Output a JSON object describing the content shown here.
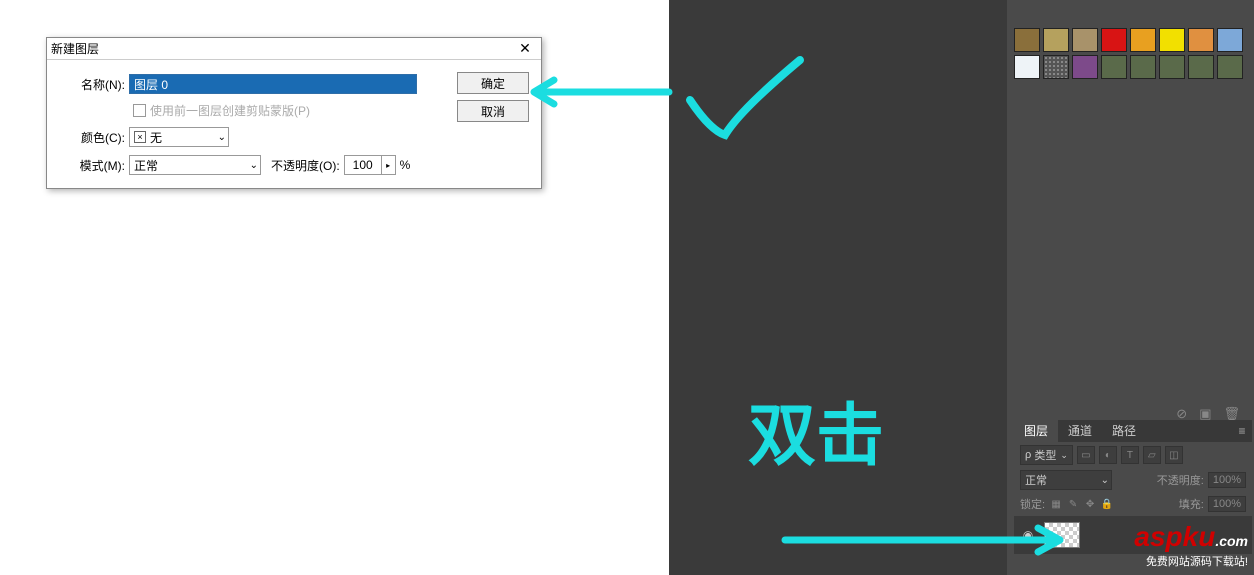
{
  "dialog": {
    "title": "新建图层",
    "name_label": "名称(N):",
    "name_value": "图层 0",
    "clip_mask_label": "使用前一图层创建剪贴蒙版(P)",
    "color_label": "颜色(C):",
    "color_value": "无",
    "mode_label": "模式(M):",
    "mode_value": "正常",
    "opacity_label": "不透明度(O):",
    "opacity_value": "100",
    "opacity_unit": "%",
    "ok": "确定",
    "cancel": "取消"
  },
  "swatches": [
    "#8a6f3b",
    "#b5a15e",
    "#a8926a",
    "#d81414",
    "#e8a020",
    "#f2e000",
    "#e09040",
    "#7da8d8",
    "#eef3f7",
    "#666666",
    "#7d4a8a",
    "#5a6a4a",
    "#5a6a4a",
    "#5a6a4a",
    "#5a6a4a",
    "#5a6a4a"
  ],
  "swatch_special": {
    "index": 9,
    "type": "pattern"
  },
  "layers_panel": {
    "tabs": [
      "图层",
      "通道",
      "路径"
    ],
    "active_tab": 0,
    "kind_label": "类型",
    "blend_mode": "正常",
    "opacity_label": "不透明度:",
    "opacity_value": "100%",
    "lock_label": "锁定:",
    "fill_label": "填充:",
    "fill_value": "100%",
    "search_icon": "ρ"
  },
  "annotations": {
    "double_click": "双击"
  },
  "watermark": {
    "main": "aspku",
    "dotcom": ".com",
    "sub": "免费网站源码下载站!"
  }
}
